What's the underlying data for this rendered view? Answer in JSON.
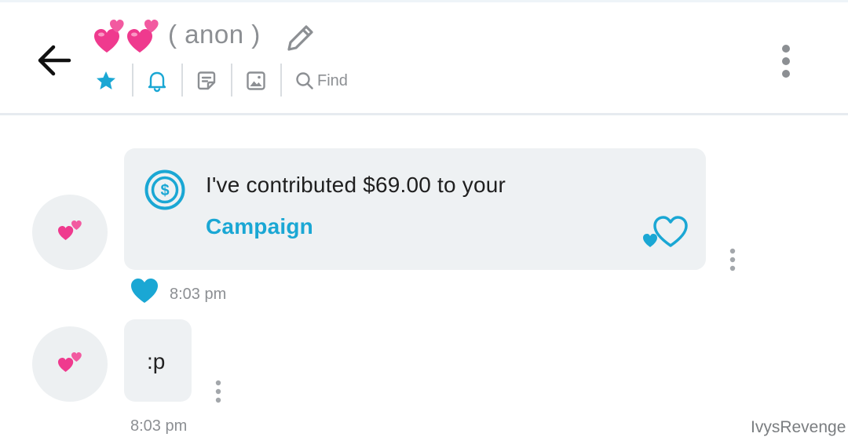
{
  "header": {
    "title_emoji": "💞💞",
    "title_name": "( anon )",
    "find_label": "Find",
    "icons": [
      "back-arrow-icon",
      "edit-pencil-icon",
      "star-icon",
      "bell-icon",
      "sticky-note-icon",
      "image-icon",
      "search-icon",
      "more-vertical-icon"
    ]
  },
  "messages": [
    {
      "type": "contribution",
      "avatar_emoji": "💕",
      "text": "I've contributed $69.00 to your",
      "link": "Campaign",
      "time": "8:03 pm",
      "liked": true,
      "icons": [
        "dollar-coin-icon",
        "hearts-icon",
        "heart-like-icon",
        "more-vertical-icon"
      ]
    },
    {
      "type": "text",
      "avatar_emoji": "💕",
      "text": ":p",
      "time": "8:03 pm"
    }
  ],
  "watermark": "IvysRevenge",
  "colors": {
    "accent": "#1aa7d4",
    "bubble": "#eef1f3",
    "muted": "#8c8f93",
    "emoji_pink": "#ef3a8e"
  }
}
